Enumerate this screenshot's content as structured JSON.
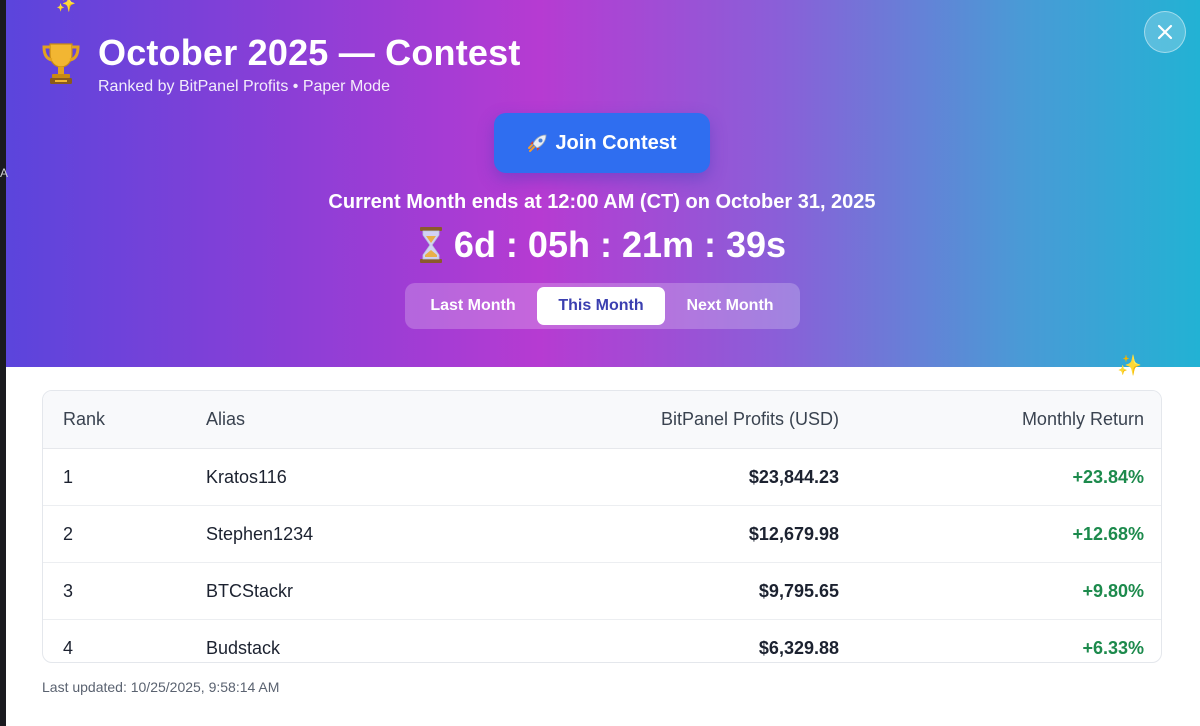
{
  "header": {
    "title": "October 2025 — Contest",
    "subtitle": "Ranked by BitPanel Profits • Paper Mode",
    "join_label": "Join Contest",
    "ends_text": "Current Month ends at 12:00 AM (CT) on October 31, 2025",
    "countdown": "6d : 05h : 21m : 39s"
  },
  "tabs": [
    {
      "label": "Last Month",
      "active": false
    },
    {
      "label": "This Month",
      "active": true
    },
    {
      "label": "Next Month",
      "active": false
    }
  ],
  "table": {
    "columns": [
      "Rank",
      "Alias",
      "BitPanel Profits (USD)",
      "Monthly Return"
    ],
    "rows": [
      {
        "rank": "1",
        "alias": "Kratos116",
        "profit": "$23,844.23",
        "return": "+23.84%"
      },
      {
        "rank": "2",
        "alias": "Stephen1234",
        "profit": "$12,679.98",
        "return": "+12.68%"
      },
      {
        "rank": "3",
        "alias": "BTCStackr",
        "profit": "$9,795.65",
        "return": "+9.80%"
      },
      {
        "rank": "4",
        "alias": "Budstack",
        "profit": "$6,329.88",
        "return": "+6.33%"
      }
    ]
  },
  "footer": {
    "last_updated": "Last updated: 10/25/2025, 9:58:14 AM"
  },
  "edge_mark": "A",
  "colors": {
    "accent_blue": "#2f6ef0",
    "positive_green": "#1c8a4c",
    "active_tab_text": "#3b3fb0"
  }
}
